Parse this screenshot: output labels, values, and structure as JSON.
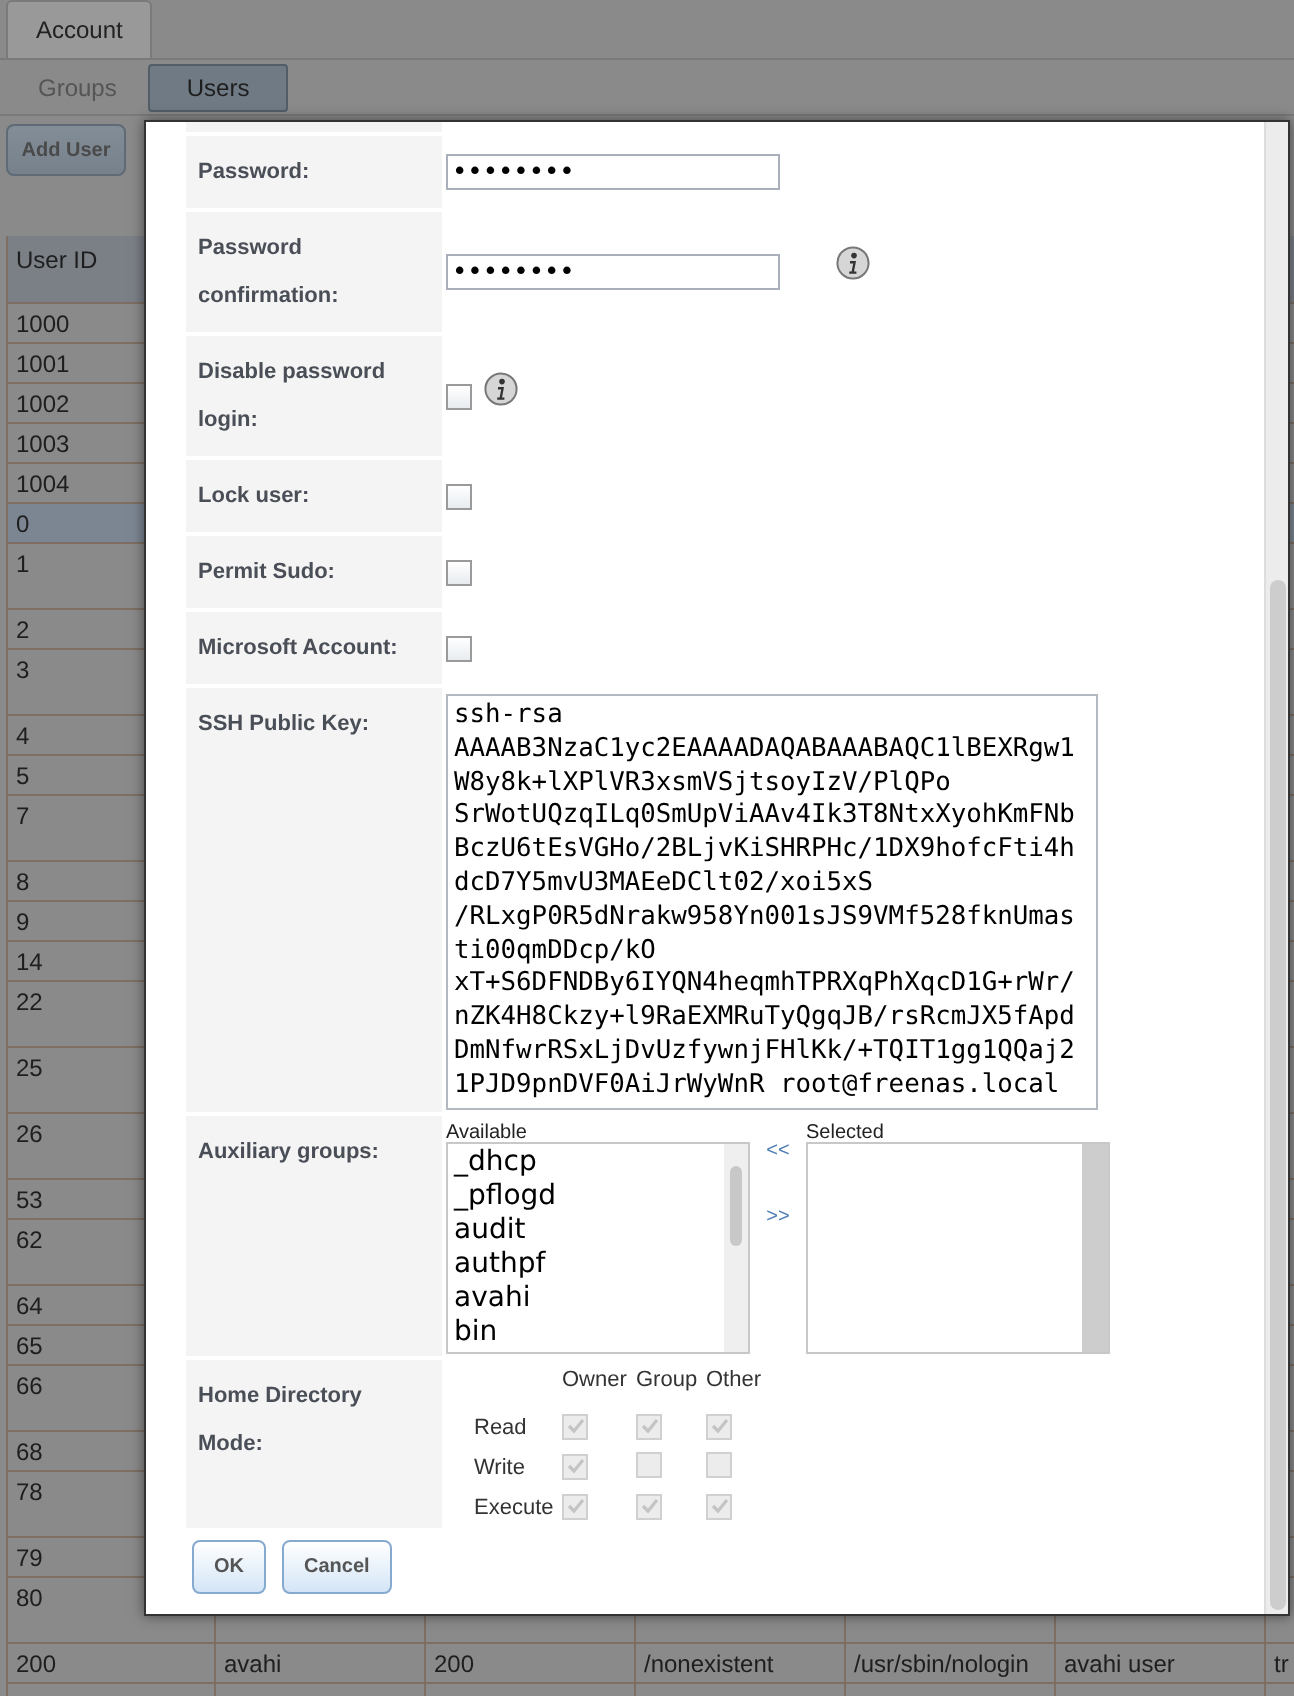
{
  "tabs": [
    {
      "label": "Account",
      "selected": true
    }
  ],
  "subtabs": [
    {
      "label": "Groups",
      "selected": false
    },
    {
      "label": "Users",
      "selected": true
    }
  ],
  "add_button": "Add User",
  "table": {
    "columns": [
      "User ID"
    ],
    "rows": [
      {
        "cells": [
          "1000"
        ],
        "selected": false
      },
      {
        "cells": [
          "1001"
        ],
        "selected": false
      },
      {
        "cells": [
          "1002"
        ],
        "selected": false
      },
      {
        "cells": [
          "1003"
        ],
        "selected": false
      },
      {
        "cells": [
          "1004"
        ],
        "selected": false
      },
      {
        "cells": [
          "0"
        ],
        "selected": true
      },
      {
        "cells": [
          "1"
        ],
        "selected": false
      },
      {
        "cells": [
          "2"
        ],
        "selected": false
      },
      {
        "cells": [
          "3"
        ],
        "selected": false
      },
      {
        "cells": [
          "4"
        ],
        "selected": false
      },
      {
        "cells": [
          "5"
        ],
        "selected": false
      },
      {
        "cells": [
          "7"
        ],
        "selected": false
      },
      {
        "cells": [
          "8"
        ],
        "selected": false
      },
      {
        "cells": [
          "9"
        ],
        "selected": false
      },
      {
        "cells": [
          "14"
        ],
        "selected": false
      },
      {
        "cells": [
          "22"
        ],
        "selected": false
      },
      {
        "cells": [
          "25"
        ],
        "selected": false
      },
      {
        "cells": [
          "26"
        ],
        "selected": false
      },
      {
        "cells": [
          "53"
        ],
        "selected": false
      },
      {
        "cells": [
          "62"
        ],
        "selected": false
      },
      {
        "cells": [
          "64"
        ],
        "selected": false
      },
      {
        "cells": [
          "65"
        ],
        "selected": false
      },
      {
        "cells": [
          "66"
        ],
        "selected": false
      },
      {
        "cells": [
          "68"
        ],
        "selected": false
      },
      {
        "cells": [
          "78"
        ],
        "selected": false
      },
      {
        "cells": [
          "79"
        ],
        "selected": false
      },
      {
        "cells": [
          "80"
        ],
        "selected": false
      },
      {
        "cells": [
          "200",
          "avahi",
          "200",
          "/nonexistent",
          "/usr/sbin/nologin",
          "avahi user",
          "tr"
        ],
        "selected": false
      }
    ]
  },
  "dialog": {
    "fields": [
      {
        "kind": "password",
        "label": "Password:",
        "value": "••••••••",
        "info": false
      },
      {
        "kind": "password",
        "label": "Password confirmation:",
        "value": "••••••••",
        "info": true
      },
      {
        "kind": "checkbox",
        "label": "Disable password login:",
        "checked": false,
        "info": true
      },
      {
        "kind": "checkbox",
        "label": "Lock user:",
        "checked": false,
        "info": false
      },
      {
        "kind": "checkbox",
        "label": "Permit Sudo:",
        "checked": false,
        "info": false
      },
      {
        "kind": "checkbox",
        "label": "Microsoft Account:",
        "checked": false,
        "info": false
      },
      {
        "kind": "textarea",
        "label": "SSH Public Key:",
        "value": "ssh-rsa\nAAAAB3NzaC1yc2EAAAADAQABAAABAQC1lBEXRgw1\nW8y8k+lXPlVR3xsmVSjtsoyIzV/PlQPo\nSrWotUQzqILq0SmUpViAAv4Ik3T8NtxXyohKmFNb\nBczU6tEsVGHo/2BLjvKiSHRPHc/1DX9hofcFti4h\ndcD7Y5mvU3MAEeDClt02/xoi5xS\n/RLxgP0R5dNrakw958Yn001sJS9VMf528fknUmas\nti00qmDDcp/kO\nxT+S6DFNDBy6IYQN4heqmhTPRXqPhXqcD1G+rWr/\nnZK4H8Ckzy+l9RaEXMRuTyQgqJB/rsRcmJX5fApd\nDmNfwrRSxLjDvUzfywnjFHlKk/+TQIT1gg1QQaj2\n1PJD9pnDVF0AiJrWyWnR root@freenas.local"
      },
      {
        "kind": "dual_list",
        "label": "Auxiliary groups:",
        "available_label": "Available",
        "available": [
          "_dhcp",
          "_pflogd",
          "audit",
          "authpf",
          "avahi",
          "bin"
        ],
        "selected_label": "Selected",
        "remove": "<<",
        "add": ">>"
      },
      {
        "kind": "permissions",
        "label": "Home Directory Mode:",
        "columns": [
          "Owner",
          "Group",
          "Other"
        ],
        "rows": [
          {
            "label": "Read",
            "checked": [
              true,
              true,
              true
            ]
          },
          {
            "label": "Write",
            "checked": [
              true,
              false,
              false
            ]
          },
          {
            "label": "Execute",
            "checked": [
              true,
              true,
              true
            ]
          }
        ]
      }
    ],
    "buttons": [
      "OK",
      "Cancel"
    ]
  }
}
